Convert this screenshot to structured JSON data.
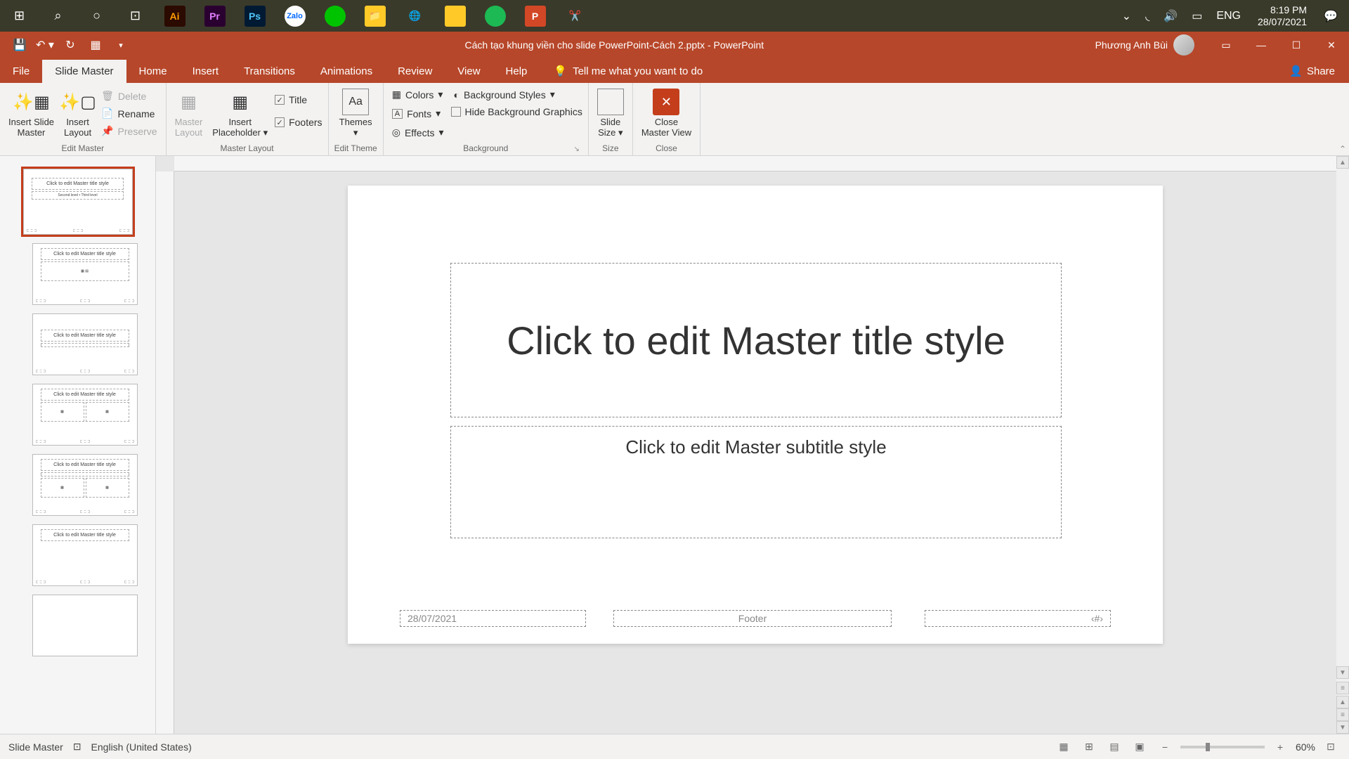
{
  "taskbar": {
    "lang": "ENG",
    "time": "8:19 PM",
    "date": "28/07/2021"
  },
  "titlebar": {
    "filename": "Cách tạo khung viền cho slide PowerPoint-Cách 2.pptx  -  PowerPoint",
    "user": "Phương Anh Bùi"
  },
  "tabs": {
    "file": "File",
    "slide_master": "Slide Master",
    "home": "Home",
    "insert": "Insert",
    "transitions": "Transitions",
    "animations": "Animations",
    "review": "Review",
    "view": "View",
    "help": "Help",
    "tell_me": "Tell me what you want to do",
    "share": "Share"
  },
  "ribbon": {
    "edit_master": {
      "insert_slide_master": "Insert Slide\nMaster",
      "insert_layout": "Insert\nLayout",
      "delete": "Delete",
      "rename": "Rename",
      "preserve": "Preserve",
      "label": "Edit Master"
    },
    "master_layout": {
      "master_layout": "Master\nLayout",
      "insert_placeholder": "Insert\nPlaceholder",
      "title": "Title",
      "footers": "Footers",
      "label": "Master Layout"
    },
    "edit_theme": {
      "themes": "Themes",
      "label": "Edit Theme"
    },
    "background": {
      "colors": "Colors",
      "fonts": "Fonts",
      "effects": "Effects",
      "bg_styles": "Background Styles",
      "hide_bg": "Hide Background Graphics",
      "label": "Background"
    },
    "size": {
      "slide_size": "Slide\nSize",
      "label": "Size"
    },
    "close": {
      "close_master": "Close\nMaster View",
      "label": "Close"
    }
  },
  "slide": {
    "title": "Click to edit Master title style",
    "subtitle": "Click to edit Master subtitle style",
    "date": "28/07/2021",
    "footer": "Footer",
    "num": "‹#›",
    "thumb_title": "Click to edit Master title style"
  },
  "status": {
    "mode": "Slide Master",
    "lang": "English (United States)",
    "zoom": "60%"
  }
}
